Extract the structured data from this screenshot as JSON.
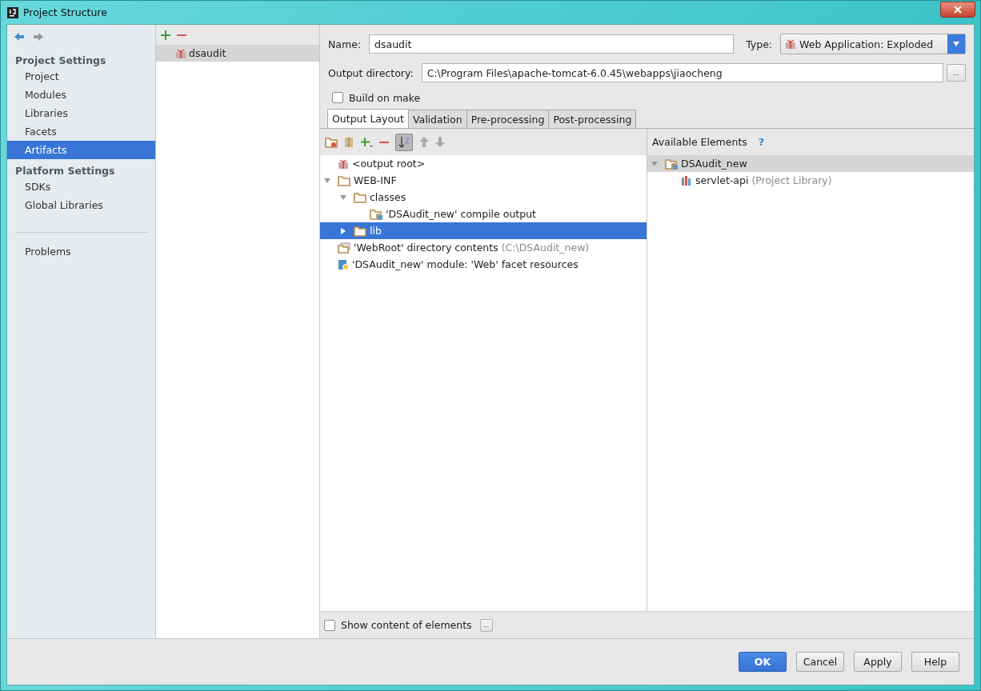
{
  "window": {
    "title": "Project Structure"
  },
  "sidebar": {
    "groups": [
      {
        "title": "Project Settings",
        "items": [
          {
            "label": "Project",
            "selected": false
          },
          {
            "label": "Modules",
            "selected": false
          },
          {
            "label": "Libraries",
            "selected": false
          },
          {
            "label": "Facets",
            "selected": false
          },
          {
            "label": "Artifacts",
            "selected": true
          }
        ]
      },
      {
        "title": "Platform Settings",
        "items": [
          {
            "label": "SDKs",
            "selected": false
          },
          {
            "label": "Global Libraries",
            "selected": false
          }
        ]
      }
    ],
    "footer_items": [
      {
        "label": "Problems",
        "selected": false
      }
    ]
  },
  "artifacts": [
    {
      "label": "dsaudit",
      "selected": true
    }
  ],
  "form": {
    "name_label": "Name:",
    "name_value": "dsaudit",
    "type_label": "Type:",
    "type_value": "Web Application: Exploded",
    "output_label": "Output directory:",
    "output_value": "C:\\Program Files\\apache-tomcat-6.0.45\\webapps\\jiaocheng",
    "browse_button": "...",
    "build_on_make": {
      "label": "Build on make",
      "checked": false
    }
  },
  "tabs": [
    {
      "label": "Output Layout",
      "selected": true
    },
    {
      "label": "Validation",
      "selected": false
    },
    {
      "label": "Pre-processing",
      "selected": false
    },
    {
      "label": "Post-processing",
      "selected": false
    }
  ],
  "layout_tree": [
    {
      "kind": "artifact",
      "label": "<output root>"
    },
    {
      "kind": "folder",
      "label": "WEB-INF",
      "expanded": true,
      "selected": false,
      "children": [
        {
          "kind": "folder",
          "label": "classes",
          "expanded": true,
          "selected": false,
          "children": [
            {
              "kind": "output",
              "label": "'DSAudit_new' compile output",
              "selected": false
            }
          ]
        },
        {
          "kind": "folder",
          "label": "lib",
          "expanded": false,
          "selected": true
        }
      ]
    },
    {
      "kind": "directory",
      "label": "'WebRoot' directory contents",
      "note": "(C:\\DSAudit_new)",
      "selected": false
    },
    {
      "kind": "facet",
      "label": "'DSAudit_new' module: 'Web' facet resources",
      "selected": false
    }
  ],
  "available": {
    "title": "Available Elements",
    "help": "?",
    "tree": [
      {
        "kind": "output",
        "label": "DSAudit_new",
        "expanded": true,
        "selected": true,
        "children": [
          {
            "kind": "library",
            "label": "servlet-api",
            "note": "(Project Library)",
            "selected": false
          }
        ]
      }
    ]
  },
  "show_content": {
    "label": "Show content of elements",
    "checked": false,
    "options_button": "..."
  },
  "buttons": [
    {
      "label": "OK",
      "kind": "primary"
    },
    {
      "label": "Cancel",
      "kind": "normal"
    },
    {
      "label": "Apply",
      "kind": "normal"
    },
    {
      "label": "Help",
      "kind": "normal"
    }
  ]
}
